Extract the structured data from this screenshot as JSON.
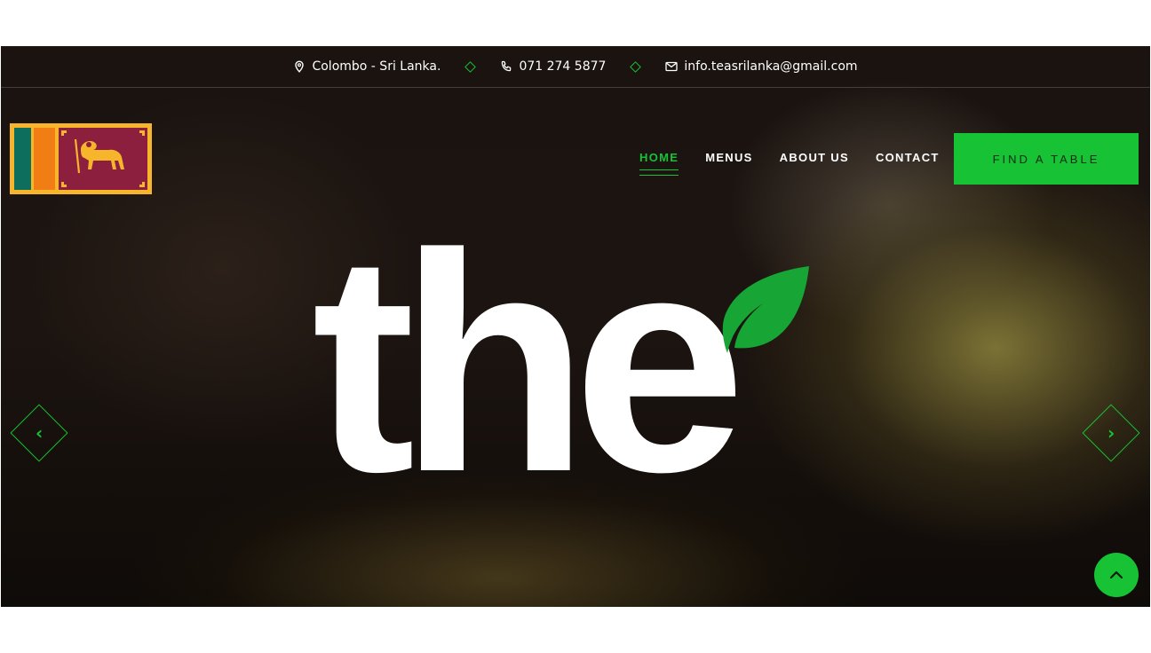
{
  "topbar": {
    "location": "Colombo - Sri Lanka.",
    "phone": "071 274 5877",
    "email": "info.teasrilanka@gmail.com"
  },
  "nav": {
    "items": [
      {
        "label": "HOME",
        "active": true
      },
      {
        "label": "MENUS",
        "active": false
      },
      {
        "label": "ABOUT US",
        "active": false
      },
      {
        "label": "CONTACT",
        "active": false
      }
    ],
    "cta": "FIND A TABLE"
  },
  "hero": {
    "headline": "the"
  },
  "icons": {
    "location": "map-pin-icon",
    "phone": "phone-icon",
    "email": "mail-icon",
    "prev": "chevron-left-icon",
    "next": "chevron-right-icon",
    "to_top": "chevron-up-icon",
    "leaf": "leaf-icon",
    "logo": "sri-lanka-flag-logo"
  },
  "colors": {
    "accent": "#17c234",
    "background": "#120d0a",
    "text": "#ffffff"
  }
}
